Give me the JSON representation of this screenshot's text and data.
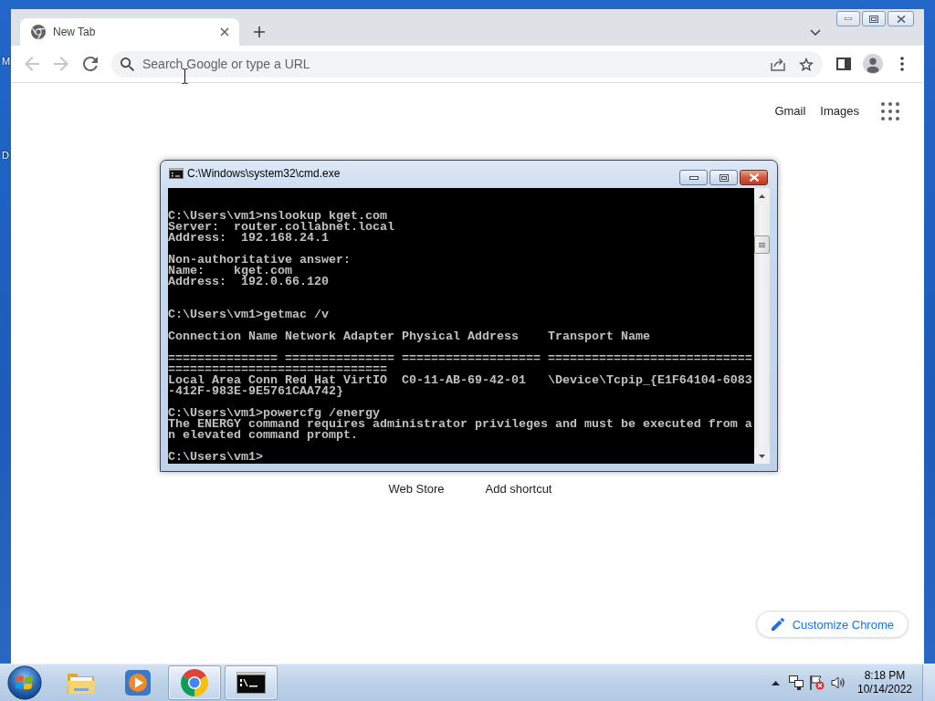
{
  "desktop": {
    "icon_labels": [
      "M",
      "D"
    ]
  },
  "browser": {
    "tabs": [
      {
        "title": "New Tab",
        "selected": true
      }
    ],
    "toolbar": {
      "back": {
        "disabled": true
      },
      "forward": {
        "disabled": true
      }
    },
    "omnibox": {
      "placeholder": "Search Google or type a URL"
    },
    "header_links": [
      "Gmail",
      "Images"
    ],
    "shortcuts": [
      {
        "label": "Web Store"
      },
      {
        "label": "Add shortcut"
      }
    ],
    "customize_button": "Customize Chrome"
  },
  "cmd_window": {
    "title": "C:\\Windows\\system32\\cmd.exe",
    "console_text": "C:\\Users\\vm1>nslookup kget.com\nServer:  router.collabnet.local\nAddress:  192.168.24.1\n\nNon-authoritative answer:\nName:    kget.com\nAddress:  192.0.66.120\n\n\nC:\\Users\\vm1>getmac /v\n\nConnection Name Network Adapter Physical Address    Transport Name\n\n=============== =============== =================== ============================\n==============================\nLocal Area Conn Red Hat VirtIO  C0-11-AB-69-42-01   \\Device\\Tcpip_{E1F64104-6083\n-412F-983E-9E5761CAA742}\n\nC:\\Users\\vm1>powercfg /energy\nThe ENERGY command requires administrator privileges and must be executed from a\nn elevated command prompt.\n\nC:\\Users\\vm1>"
  },
  "taskbar": {
    "apps": [
      {
        "kind": "folder",
        "open": false
      },
      {
        "kind": "media",
        "open": false
      },
      {
        "kind": "browser",
        "open": true
      },
      {
        "kind": "terminal",
        "open": true
      }
    ],
    "clock": {
      "time": "8:18 PM",
      "date": "10/14/2022"
    }
  }
}
